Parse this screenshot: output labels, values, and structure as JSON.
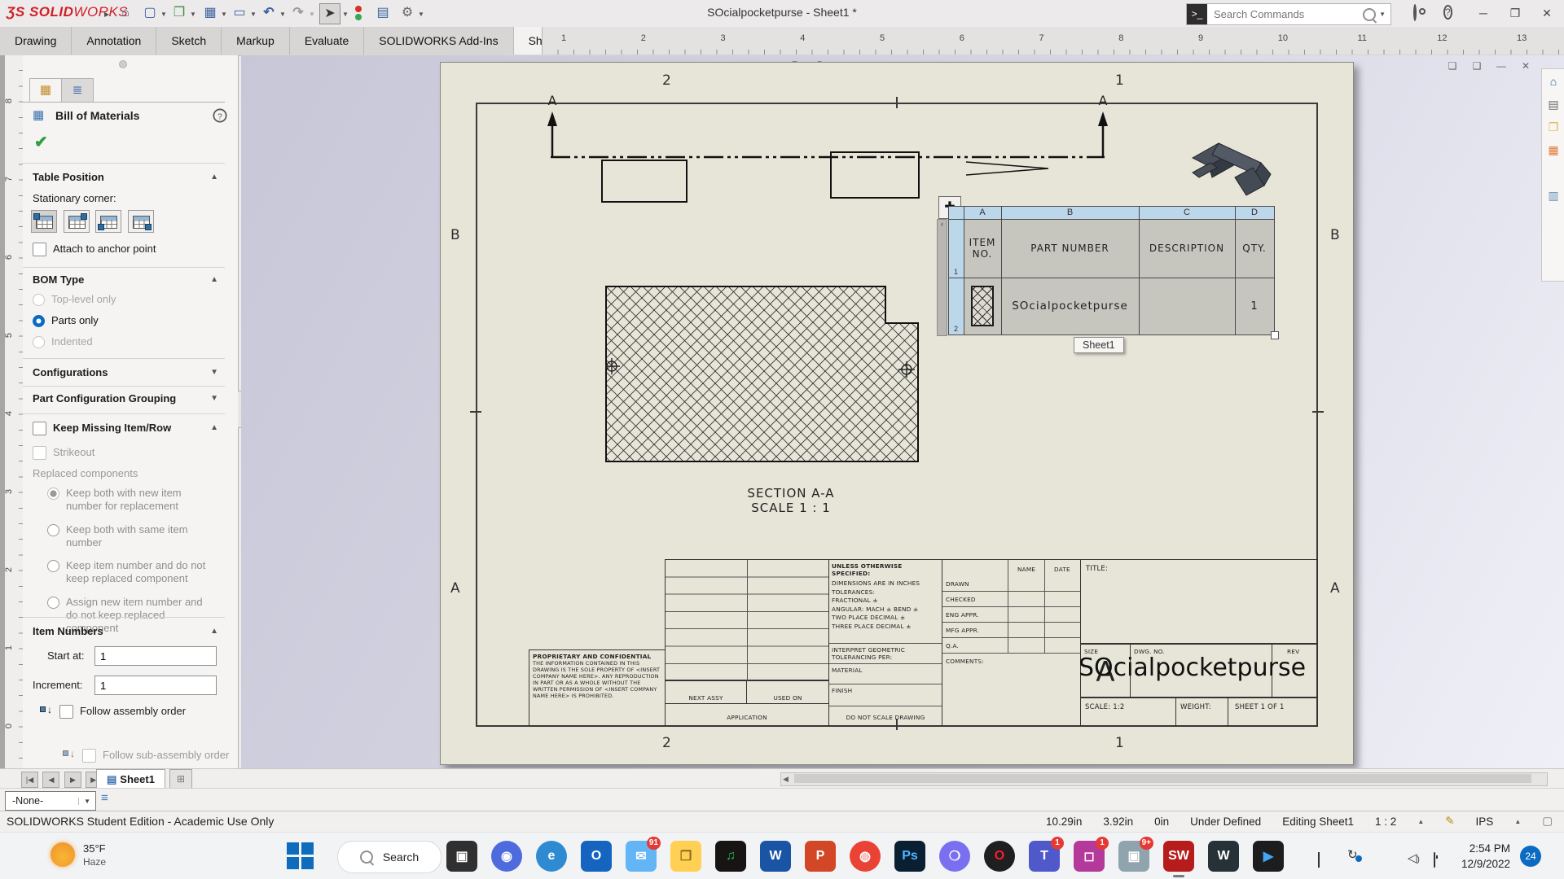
{
  "colors": {
    "accent_blue": "#0b6bc2",
    "sheet_beige": "#e7e5d8",
    "bom_header_blue": "#bcd6ea",
    "bom_cell_gray": "#c6c5be",
    "badge_red": "#e53935",
    "logo_red": "#d21f26"
  },
  "titlebar": {
    "logo_glyph": "ƷS",
    "logo_bold": "SOLID",
    "logo_light": "WORKS",
    "doc_title": "SOcialpocketpurse - Sheet1 *",
    "search_placeholder": "Search Commands"
  },
  "active_tab": "Sheet Format",
  "tabs": [
    "Drawing",
    "Annotation",
    "Sketch",
    "Markup",
    "Evaluate",
    "SOLIDWORKS Add-Ins",
    "Sheet Format"
  ],
  "h_ruler": [
    "1",
    "2",
    "3",
    "4",
    "5",
    "6",
    "7",
    "8",
    "9",
    "10",
    "11",
    "12",
    "13"
  ],
  "v_ruler": [
    "8",
    "7",
    "6",
    "5",
    "4",
    "3",
    "2",
    "1",
    "0"
  ],
  "panel": {
    "title": "Bill of Materials",
    "table_position": {
      "header": "Table Position",
      "stationary_label": "Stationary corner:",
      "attach_label": "Attach to anchor point"
    },
    "bom_type": {
      "header": "BOM Type",
      "options": [
        {
          "label": "Top-level only",
          "state": "disabled"
        },
        {
          "label": "Parts only",
          "state": "selected"
        },
        {
          "label": "Indented",
          "state": "disabled"
        }
      ]
    },
    "configurations_header": "Configurations",
    "part_config_header": "Part Configuration Grouping",
    "keep_missing": {
      "header": "Keep Missing Item/Row",
      "strikeout": "Strikeout",
      "replaced_label": "Replaced components",
      "options": [
        {
          "label": "Keep both with new item number for replacement",
          "state": "selgray"
        },
        {
          "label": "Keep both with same item number",
          "state": "norm"
        },
        {
          "label": "Keep item number and do not keep replaced component",
          "state": "norm"
        },
        {
          "label": "Assign new item number and do not keep replaced component",
          "state": "norm"
        }
      ]
    },
    "item_numbers": {
      "header": "Item Numbers",
      "start_label": "Start at:",
      "start_value": "1",
      "increment_label": "Increment:",
      "increment_value": "1",
      "follow_assembly": "Follow assembly order",
      "follow_sub": "Follow sub-assembly order"
    }
  },
  "drawing": {
    "zones": {
      "top": [
        "2",
        "1"
      ],
      "bottom": [
        "2",
        "1"
      ],
      "left": [
        "B",
        "A"
      ],
      "right": [
        "B",
        "A"
      ]
    },
    "section_view": {
      "arrow_label": "A"
    },
    "section_label": {
      "line1": "SECTION A-A",
      "line2": "SCALE 1 : 1"
    },
    "bom_table": {
      "col_headers": [
        "A",
        "B",
        "C",
        "D"
      ],
      "row_headers": [
        "1",
        "2"
      ],
      "header_row": [
        "ITEM NO.",
        "PART NUMBER",
        "DESCRIPTION",
        "QTY."
      ],
      "part_number": "SOcialpocketpurse",
      "description": "",
      "qty": "1",
      "tooltip": "Sheet1"
    },
    "title_block": {
      "unless": "UNLESS OTHERWISE SPECIFIED:",
      "dims": [
        "DIMENSIONS ARE IN INCHES",
        "TOLERANCES:",
        "FRACTIONAL ±",
        "ANGULAR: MACH ±   BEND ±",
        "TWO PLACE DECIMAL    ±",
        "THREE PLACE DECIMAL  ±"
      ],
      "interpret_1": "INTERPRET GEOMETRIC",
      "interpret_2": "TOLERANCING PER:",
      "material": "MATERIAL",
      "finish": "FINISH",
      "do_not_scale": "DO NOT SCALE DRAWING",
      "proprietary_title": "PROPRIETARY AND CONFIDENTIAL",
      "proprietary_body": "THE INFORMATION CONTAINED IN THIS DRAWING IS THE SOLE PROPERTY OF <INSERT COMPANY NAME HERE>. ANY REPRODUCTION IN PART OR AS A WHOLE WITHOUT THE WRITTEN PERMISSION OF <INSERT COMPANY NAME HERE> IS PROHIBITED.",
      "next_assy": "NEXT ASSY",
      "used_on": "USED ON",
      "application": "APPLICATION",
      "name_col": "NAME",
      "date_col": "DATE",
      "rows": [
        "DRAWN",
        "CHECKED",
        "ENG APPR.",
        "MFG APPR.",
        "Q.A."
      ],
      "comments": "COMMENTS:",
      "title_label": "TITLE:",
      "size_label": "SIZE",
      "size_value": "A",
      "dwg_no_label": "DWG. NO.",
      "rev_label": "REV",
      "dwg_title": "SOcialpocketpurse",
      "scale": "SCALE: 1:2",
      "weight": "WEIGHT:",
      "sheet_of": "SHEET 1 OF 1"
    }
  },
  "bottom": {
    "sheet_tab": "Sheet1",
    "layer_value": "-None-",
    "status_left": "SOLIDWORKS Student Edition - Academic Use Only",
    "status_fields": [
      "10.29in",
      "3.92in",
      "0in",
      "Under Defined",
      "Editing Sheet1",
      "1 : 2"
    ],
    "units": "IPS"
  },
  "taskbar": {
    "weather_temp": "35°F",
    "weather_desc": "Haze",
    "search_label": "Search",
    "time": "2:54 PM",
    "date": "12/9/2022",
    "notification_count": "24",
    "apps": [
      {
        "name": "console",
        "bg": "#303030",
        "fg": "#ffffff",
        "glyph": "▣"
      },
      {
        "name": "chat",
        "bg": "#4d6bdd",
        "fg": "#ffffff",
        "glyph": "◉",
        "round": true
      },
      {
        "name": "edge",
        "bg": "#2f8bd1",
        "fg": "#ffffff",
        "glyph": "e",
        "round": true
      },
      {
        "name": "outlook",
        "bg": "#1565c0",
        "fg": "#ffffff",
        "glyph": "O"
      },
      {
        "name": "mail",
        "bg": "#64b5f6",
        "fg": "#ffffff",
        "glyph": "✉",
        "badge": "91"
      },
      {
        "name": "file-explorer",
        "bg": "#ffd054",
        "fg": "#8a6d1a",
        "glyph": "❐"
      },
      {
        "name": "spotify",
        "bg": "#191414",
        "fg": "#1db954",
        "glyph": "♫"
      },
      {
        "name": "word",
        "bg": "#1a55a5",
        "fg": "#ffffff",
        "glyph": "W"
      },
      {
        "name": "powerpoint",
        "bg": "#d24726",
        "fg": "#ffffff",
        "glyph": "P"
      },
      {
        "name": "chrome",
        "bg": "#ea4335",
        "fg": "#ffffff",
        "glyph": "◍",
        "round": true
      },
      {
        "name": "photoshop",
        "bg": "#0b1f33",
        "fg": "#4db7ff",
        "glyph": "Ps"
      },
      {
        "name": "messenger",
        "bg": "#7a6ff0",
        "fg": "#ffffff",
        "glyph": "❍",
        "round": true
      },
      {
        "name": "opera",
        "bg": "#1f1f1f",
        "fg": "#ff1b2d",
        "glyph": "O",
        "round": true
      },
      {
        "name": "teams",
        "bg": "#5059c9",
        "fg": "#ffffff",
        "glyph": "T",
        "badge": "1"
      },
      {
        "name": "instagram",
        "bg": "#b5399b",
        "fg": "#ffffff",
        "glyph": "◻",
        "badge": "1"
      },
      {
        "name": "photos",
        "bg": "#90a4ae",
        "fg": "#ffffff",
        "glyph": "▣",
        "badge": "9+"
      },
      {
        "name": "solidworks",
        "bg": "#b71c1c",
        "fg": "#ffffff",
        "glyph": "SW",
        "active": true
      },
      {
        "name": "w-app",
        "bg": "#263238",
        "fg": "#ffffff",
        "glyph": "W"
      },
      {
        "name": "movies-tv",
        "bg": "#1d1d1d",
        "fg": "#42a5f5",
        "glyph": "▶"
      }
    ]
  }
}
